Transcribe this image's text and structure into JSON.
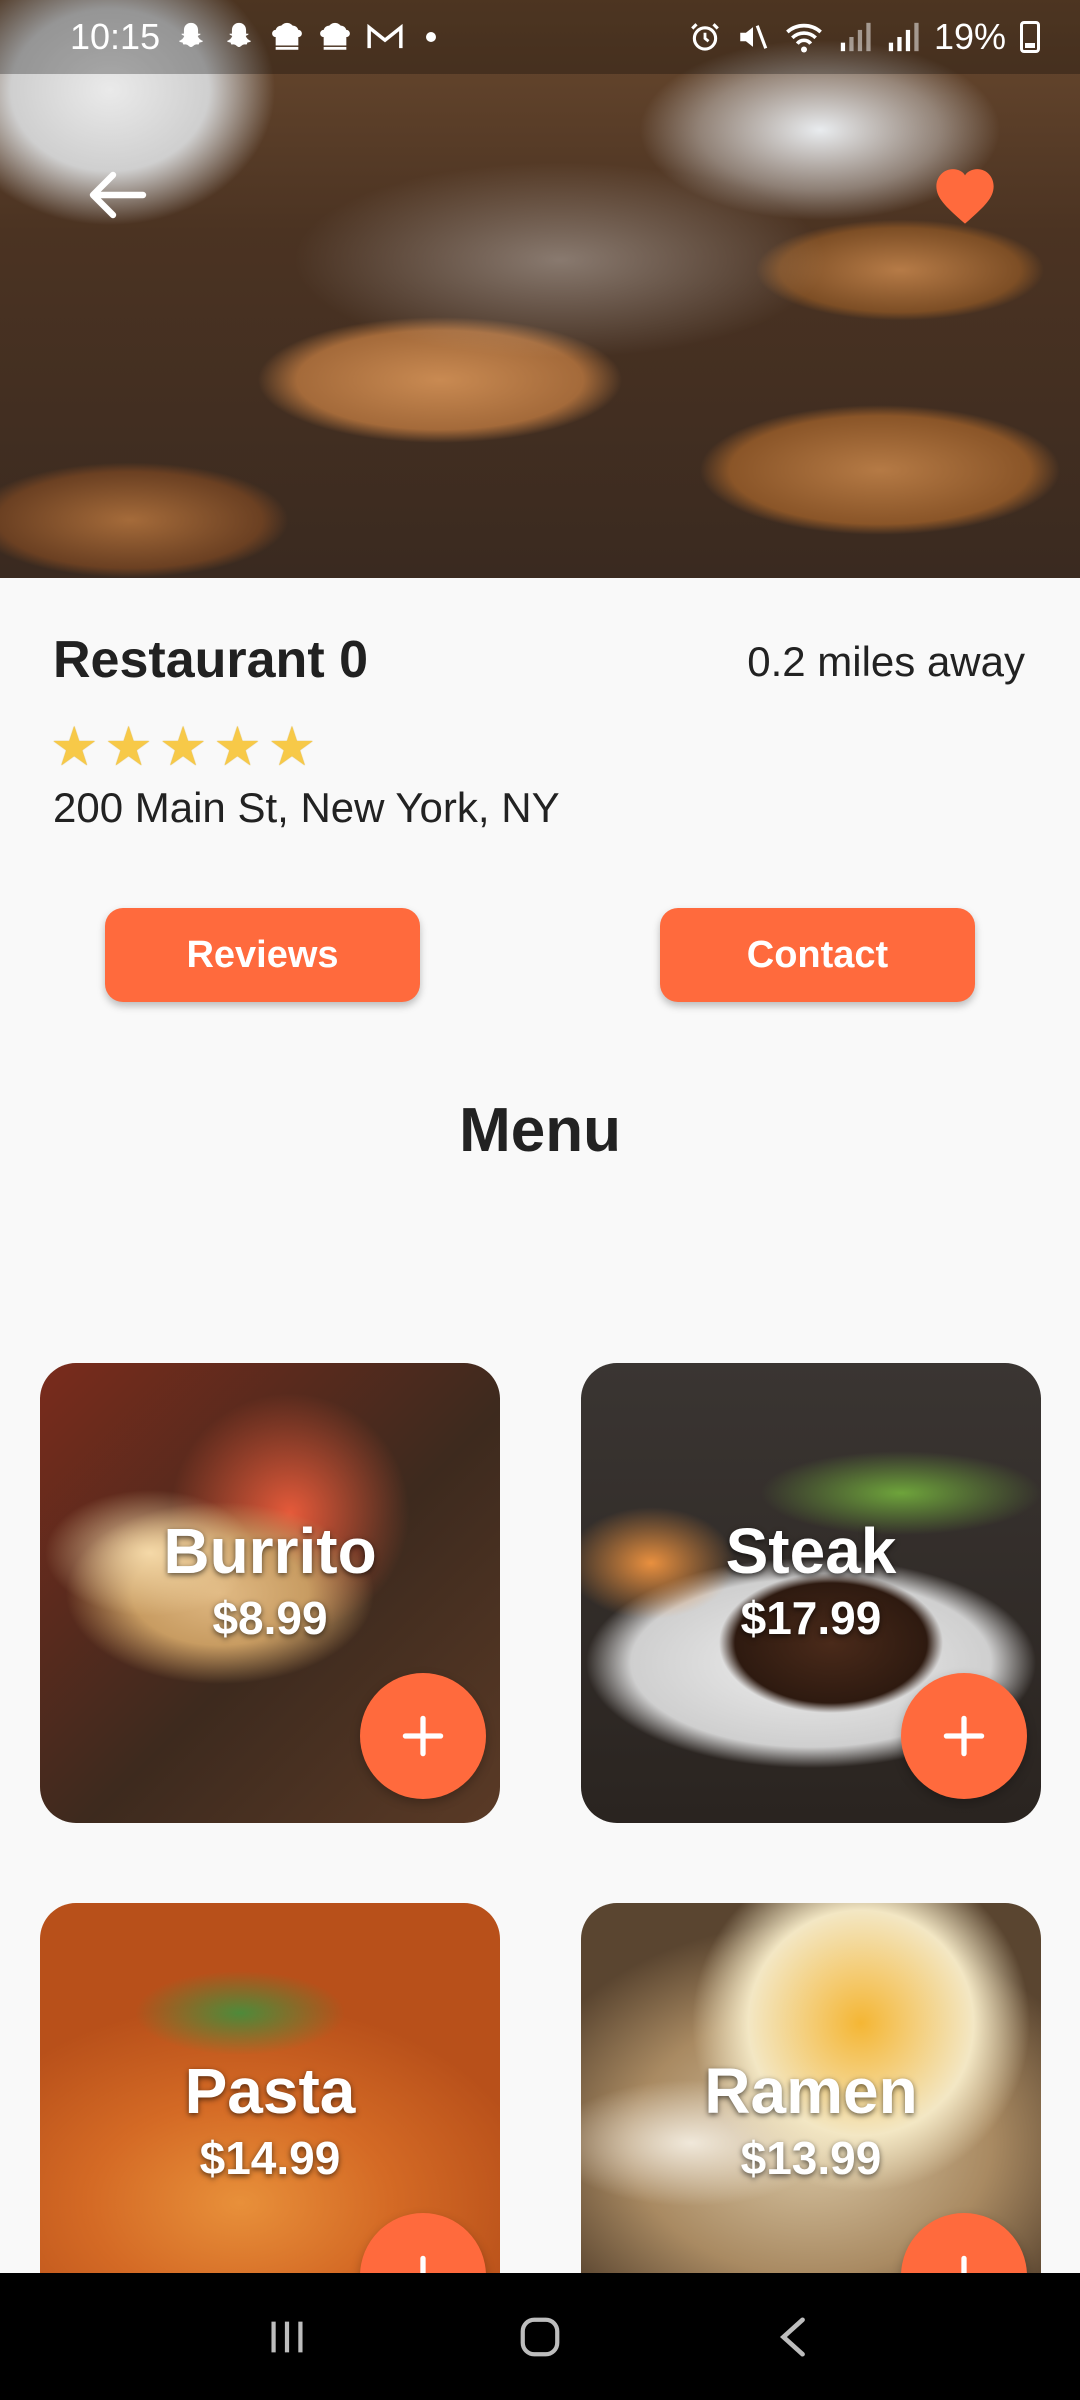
{
  "status_bar": {
    "time": "10:15",
    "battery": "19%",
    "left_icons": [
      "snapchat-icon",
      "snapchat-icon",
      "chef-hat-icon",
      "chef-hat-icon",
      "gmail-icon",
      "dot-icon"
    ],
    "right_icons": [
      "alarm-icon",
      "mute-icon",
      "wifi-icon",
      "signal-icon",
      "signal-icon",
      "battery-icon"
    ]
  },
  "hero": {
    "back_icon": "arrow-left-icon",
    "favorite_icon": "heart-icon",
    "favorite_color": "#ff6a3d"
  },
  "restaurant": {
    "name": "Restaurant 0",
    "distance": "0.2 miles away",
    "rating": 5,
    "stars": [
      "★",
      "★",
      "★",
      "★",
      "★"
    ],
    "address": "200 Main St, New York, NY"
  },
  "actions": {
    "reviews_label": "Reviews",
    "contact_label": "Contact"
  },
  "menu": {
    "title": "Menu",
    "items": [
      {
        "name": "Burrito",
        "price": "$8.99"
      },
      {
        "name": "Steak",
        "price": "$17.99"
      },
      {
        "name": "Pasta",
        "price": "$14.99"
      },
      {
        "name": "Ramen",
        "price": "$13.99"
      }
    ]
  },
  "nav_bar": {
    "buttons": [
      "recents-icon",
      "home-icon",
      "back-icon"
    ]
  },
  "colors": {
    "accent": "#ff6a3d",
    "star": "#f7c948",
    "text": "#212121"
  }
}
